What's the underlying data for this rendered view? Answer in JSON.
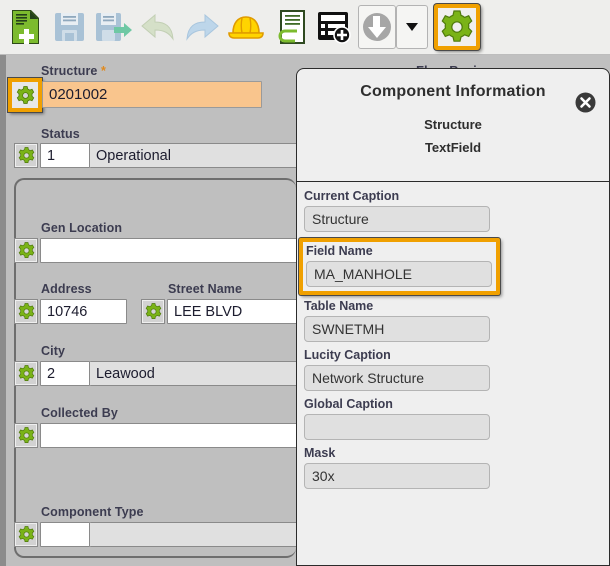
{
  "toolbar": {
    "buttons": [
      {
        "name": "new-document-icon",
        "label": "New"
      },
      {
        "name": "save-icon",
        "label": "Save"
      },
      {
        "name": "save-and-next-icon",
        "label": "Save and Next"
      },
      {
        "name": "undo-arrow-icon",
        "label": "Undo"
      },
      {
        "name": "redo-arrow-icon",
        "label": "Redo"
      },
      {
        "name": "hard-hat-icon",
        "label": "Work Order"
      },
      {
        "name": "document-attachment-icon",
        "label": "Attach Document"
      },
      {
        "name": "form-add-icon",
        "label": "Add Record"
      },
      {
        "name": "download-arrow-icon",
        "label": "Download"
      },
      {
        "name": "dropdown-caret-icon",
        "label": "More"
      },
      {
        "name": "gear-icon",
        "label": "Settings"
      }
    ]
  },
  "form": {
    "structure": {
      "label": "Structure",
      "required_marker": "*",
      "value": "0201002"
    },
    "status": {
      "label": "Status",
      "code": "1",
      "value": "Operational"
    },
    "gen_location": {
      "label": "Gen Location",
      "value": ""
    },
    "address": {
      "label": "Address",
      "value": "10746"
    },
    "street_name": {
      "label": "Street Name",
      "value": "LEE BLVD"
    },
    "city": {
      "label": "City",
      "code": "2",
      "value": "Leawood"
    },
    "collected_by": {
      "label": "Collected By",
      "value": ""
    },
    "component_type": {
      "label": "Component Type",
      "code": "",
      "value": ""
    },
    "flow_basin": {
      "label": "Flow Basin"
    }
  },
  "dialog": {
    "title": "Component Information",
    "subtitle_1": "Structure",
    "subtitle_2": "TextField",
    "close_label": "Close",
    "fields": [
      {
        "label": "Current Caption",
        "value": "Structure",
        "highlighted": false
      },
      {
        "label": "Field Name",
        "value": "MA_MANHOLE",
        "highlighted": true
      },
      {
        "label": "Table Name",
        "value": "SWNETMH",
        "highlighted": false
      },
      {
        "label": "Lucity Caption",
        "value": "Network Structure",
        "highlighted": false
      },
      {
        "label": "Global Caption",
        "value": "",
        "highlighted": false
      },
      {
        "label": "Mask",
        "value": "30x",
        "highlighted": false
      }
    ]
  },
  "colors": {
    "highlight": "#f0a000",
    "required_field_background": "#f9c58d",
    "gear_green": "#7ab317",
    "panel_gray": "#bfbfbf",
    "dialog_gray": "#efefef"
  }
}
